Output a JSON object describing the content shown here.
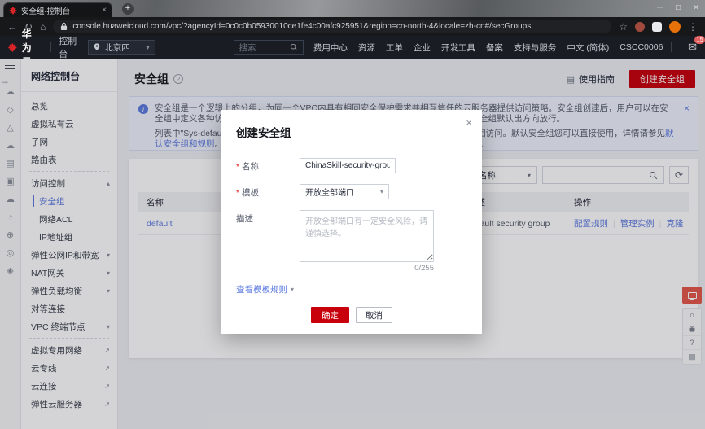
{
  "browser": {
    "tab_title": "安全组-控制台",
    "new_tab": "+",
    "url": "console.huaweicloud.com/vpc/?agencyId=0c0c0b05930010ce1fe4c00afc925951&region=cn-north-4&locale=zh-cn#/secGroups",
    "controls": {
      "minimize": "─",
      "maximize": "□",
      "close": "×"
    }
  },
  "header": {
    "brand": "华为云",
    "console_label": "控制台",
    "region": "北京四",
    "search_placeholder": "搜索",
    "nav": [
      "费用中心",
      "资源",
      "工单",
      "企业",
      "开发工具",
      "备案",
      "支持与服务",
      "中文 (简体)",
      "CSCC0006"
    ],
    "message_badge": "15"
  },
  "sidebar": {
    "title": "网络控制台",
    "items": [
      {
        "label": "总览",
        "suffix": ""
      },
      {
        "label": "虚拟私有云",
        "suffix": ""
      },
      {
        "label": "子网",
        "suffix": ""
      },
      {
        "label": "路由表",
        "suffix": ""
      },
      {
        "label": "访问控制",
        "suffix": "▴"
      },
      {
        "label": "安全组",
        "suffix": ""
      },
      {
        "label": "网络ACL",
        "suffix": ""
      },
      {
        "label": "IP地址组",
        "suffix": ""
      },
      {
        "label": "弹性公网IP和带宽",
        "suffix": "▾"
      },
      {
        "label": "NAT网关",
        "suffix": "▾"
      },
      {
        "label": "弹性负载均衡",
        "suffix": "▾"
      },
      {
        "label": "对等连接",
        "suffix": ""
      },
      {
        "label": "VPC 终端节点",
        "suffix": "▾"
      },
      {
        "label": "虚拟专用网络",
        "suffix": "↗"
      },
      {
        "label": "云专线",
        "suffix": "↗"
      },
      {
        "label": "云连接",
        "suffix": "↗"
      },
      {
        "label": "弹性云服务器",
        "suffix": "↗"
      }
    ]
  },
  "page": {
    "title": "安全组",
    "guide_label": "使用指南",
    "create_button": "创建安全组",
    "banner": {
      "p1": "安全组是一个逻辑上的分组，为同一个VPC内具有相同安全保护需求并相互信任的云服务器提供访问策略。安全组创建后，用户可以在安全组中定义各种访问规则，当云服务器加入该安全组后，即受到这些访问规则保护。安全组默认出方向放行。",
      "p2_pre": "列表中\"Sys-default\"是系统默认安全组，同一安全组内的云服务器无需添加规则即可互相访问。默认安全组您可以直接使用，详情请参见",
      "p2_link": "默认安全组和规则",
      "p2_post": "。如果默认安全组无法满足您的业务需求，您也可以创建自定义安全组。"
    },
    "filter": {
      "field_selected": "名称"
    },
    "table": {
      "col_name": "名称",
      "col_desc": "描述",
      "col_action": "操作",
      "row": {
        "name": "default",
        "description": "default security group",
        "actions": [
          "配置规则",
          "管理实例",
          "克隆"
        ]
      }
    }
  },
  "dialog": {
    "title": "创建安全组",
    "name_label": "名称",
    "name_value": "ChinaSkill-security-group",
    "template_label": "模板",
    "template_value": "开放全部端口",
    "desc_label": "描述",
    "desc_placeholder": "开放全部端口有一定安全风险，请谨慎选择。",
    "counter": "0/255",
    "rules_link": "查看模板规则",
    "ok": "确定",
    "cancel": "取消"
  },
  "rail_icons": [
    "☁",
    "◇",
    "△",
    "☁",
    "▤",
    "▣",
    "☁",
    "◔",
    "⊕",
    "◎",
    "◈"
  ],
  "fab_icons": [
    "∩",
    "◉",
    "?",
    "▤"
  ]
}
